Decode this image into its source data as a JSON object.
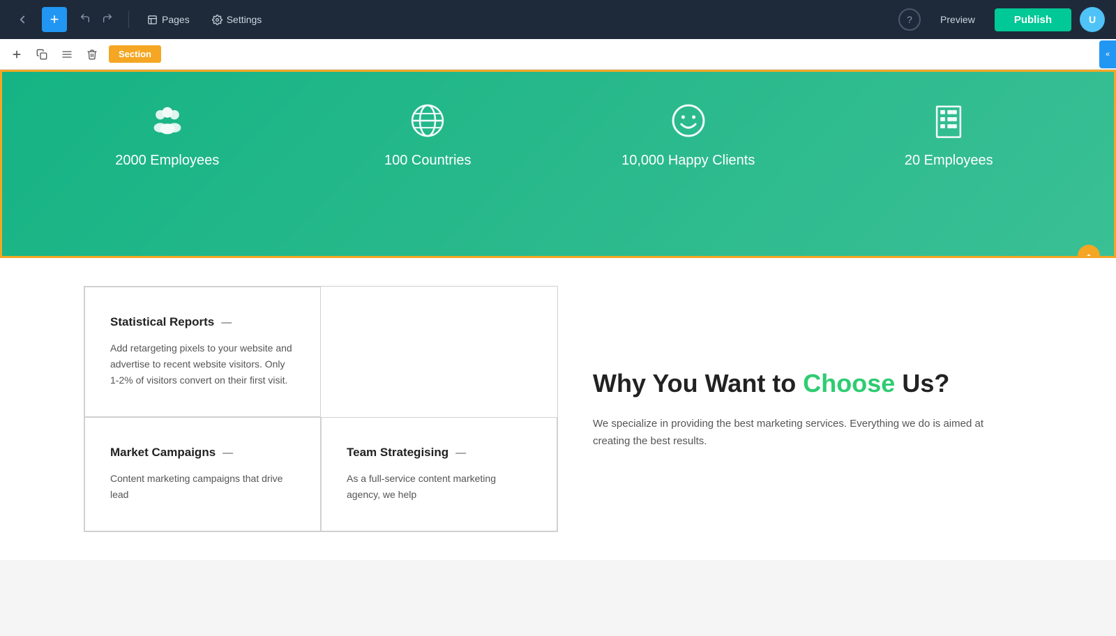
{
  "nav": {
    "back_label": "←",
    "plus_label": "+",
    "undo_label": "↩",
    "redo_label": "↪",
    "pages_label": "Pages",
    "settings_label": "Settings",
    "help_label": "?",
    "preview_label": "Preview",
    "publish_label": "Publish",
    "avatar_label": "U",
    "pages_icon": "📄",
    "settings_icon": "⚙"
  },
  "section_toolbar": {
    "add_label": "+",
    "duplicate_label": "⧉",
    "settings_label": "☰",
    "delete_label": "🗑",
    "section_badge": "Section",
    "collapse_label": "«"
  },
  "stats": {
    "items": [
      {
        "icon": "employees_group",
        "label": "2000 Employees"
      },
      {
        "icon": "globe",
        "label": "100 Countries"
      },
      {
        "icon": "smiley",
        "label": "10,000 Happy Clients"
      },
      {
        "icon": "building",
        "label": "20 Employees"
      }
    ]
  },
  "why": {
    "title_part1": "Why You Want to ",
    "title_highlight": "Choose",
    "title_part2": " Us?",
    "description": "We specialize in providing the best marketing services. Everything we do is aimed at creating the best results."
  },
  "cards": [
    {
      "title": "Statistical Reports",
      "dash": "—",
      "text": "Add retargeting pixels to your website and advertise to recent website visitors. Only 1-2% of visitors convert on their first visit."
    },
    {
      "title": "Market Campaigns",
      "dash": "—",
      "text": "Content marketing campaigns that drive lead"
    },
    {
      "title": "Team Strategising",
      "dash": "—",
      "text": "As a full-service content marketing agency, we help"
    }
  ],
  "bottom_handle": "⇅"
}
